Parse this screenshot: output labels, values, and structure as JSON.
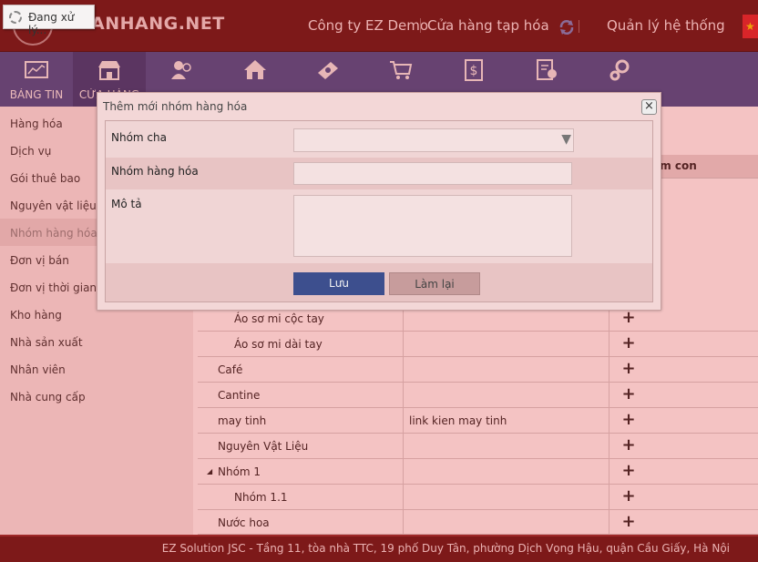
{
  "header": {
    "logo_text": "ANHANG.NET",
    "company": "Công ty EZ Demo",
    "store": "Cửa hàng tạp hóa",
    "admin": "Quản lý hệ thống",
    "loading": "Đang xử lý..."
  },
  "nav": {
    "items": [
      {
        "label": "BẢNG TIN",
        "icon": "dashboard-icon"
      },
      {
        "label": "CỬA HÀNG",
        "icon": "store-icon"
      },
      {
        "label": "",
        "icon": "users-icon"
      },
      {
        "label": "",
        "icon": "home-icon"
      },
      {
        "label": "",
        "icon": "money-icon"
      },
      {
        "label": "",
        "icon": "cart-icon"
      },
      {
        "label": "",
        "icon": "dollar-doc-icon"
      },
      {
        "label": "",
        "icon": "report-icon"
      },
      {
        "label": "",
        "icon": "gears-icon"
      }
    ]
  },
  "sidebar": {
    "items": [
      {
        "label": "Hàng hóa"
      },
      {
        "label": "Dịch vụ"
      },
      {
        "label": "Gói thuê bao"
      },
      {
        "label": "Nguyên vật liệu"
      },
      {
        "label": "Nhóm hàng hóa"
      },
      {
        "label": "Đơn vị bán"
      },
      {
        "label": "Đơn vị thời gian"
      },
      {
        "label": "Kho hàng"
      },
      {
        "label": "Nhà sản xuất"
      },
      {
        "label": "Nhân viên"
      },
      {
        "label": "Nhà cung cấp"
      }
    ],
    "active_index": 4
  },
  "grid": {
    "header_partial": "óm con",
    "rows": [
      {
        "name": "Áo sơ mi cộc tay",
        "desc": "",
        "indent": 2
      },
      {
        "name": "Áo sơ mi dài tay",
        "desc": "",
        "indent": 2
      },
      {
        "name": "Café",
        "desc": "",
        "indent": 1
      },
      {
        "name": "Cantine",
        "desc": "",
        "indent": 1
      },
      {
        "name": "may tinh",
        "desc": "link kien may tinh",
        "indent": 1
      },
      {
        "name": "Nguyên Vật Liệu",
        "desc": "",
        "indent": 1
      },
      {
        "name": "Nhóm 1",
        "desc": "",
        "indent": 1,
        "expanded": true
      },
      {
        "name": "Nhóm 1.1",
        "desc": "",
        "indent": 2
      },
      {
        "name": "Nước hoa",
        "desc": "",
        "indent": 1
      }
    ],
    "add_symbol": "+"
  },
  "dialog": {
    "title": "Thêm mới nhóm hàng hóa",
    "close_symbol": "×",
    "parent_label": "Nhóm cha",
    "group_label": "Nhóm hàng hóa",
    "desc_label": "Mô tả",
    "save_label": "Lưu",
    "reset_label": "Làm lại"
  },
  "footer": {
    "text": "EZ Solution JSC - Tầng 11, tòa nhà TTC, 19 phố Duy Tân, phường Dịch Vọng Hậu, quận Cầu Giấy, Hà Nội"
  }
}
